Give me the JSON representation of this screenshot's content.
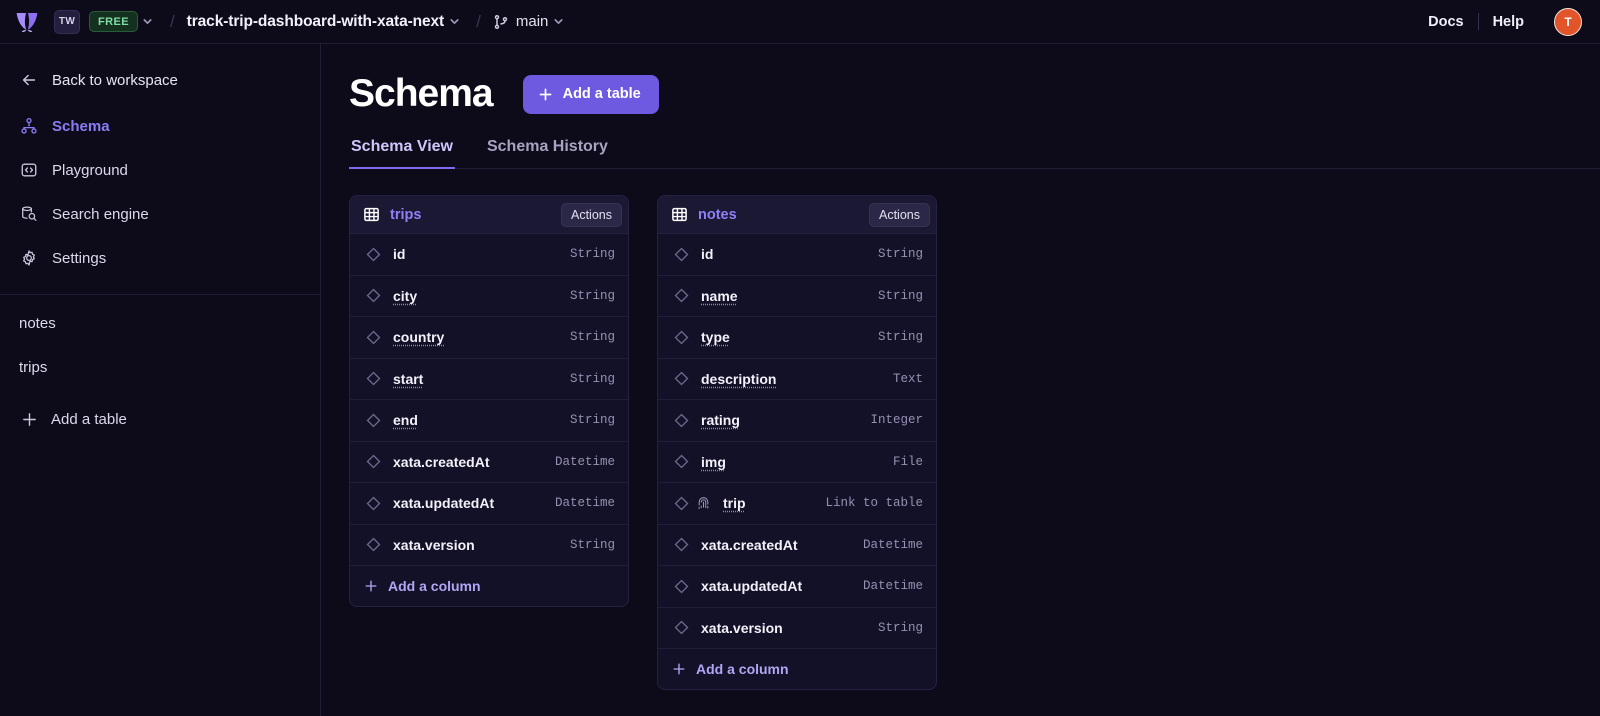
{
  "topbar": {
    "logo_icon": "xata-butterfly-logo",
    "workspace_badge": "TW",
    "plan_badge": "FREE",
    "separator": "/",
    "project_name": "track-trip-dashboard-with-xata-next",
    "branch_name": "main",
    "branch_icon": "git-branch-icon",
    "docs_label": "Docs",
    "help_label": "Help",
    "avatar_initial": "T",
    "avatar_color": "#e2552b"
  },
  "sidebar": {
    "back_label": "Back to workspace",
    "items": [
      {
        "label": "Schema",
        "icon": "schema-hierarchy-icon",
        "active": true
      },
      {
        "label": "Playground",
        "icon": "code-brackets-icon",
        "active": false
      },
      {
        "label": "Search engine",
        "icon": "database-search-icon",
        "active": false
      },
      {
        "label": "Settings",
        "icon": "gear-icon",
        "active": false
      }
    ],
    "tables": [
      "notes",
      "trips"
    ],
    "add_table_label": "Add a table"
  },
  "main": {
    "title": "Schema",
    "add_table_button": "Add a table",
    "tabs": [
      {
        "label": "Schema View",
        "active": true
      },
      {
        "label": "Schema History",
        "active": false
      }
    ],
    "accent_color": "#6d5ae0",
    "table_name_color": "#8e80f7"
  },
  "tables": [
    {
      "name": "trips",
      "actions_label": "Actions",
      "add_column_label": "Add a column",
      "columns": [
        {
          "name": "id",
          "type": "String",
          "dotted": false,
          "link": false
        },
        {
          "name": "city",
          "type": "String",
          "dotted": true,
          "link": false
        },
        {
          "name": "country",
          "type": "String",
          "dotted": true,
          "link": false
        },
        {
          "name": "start",
          "type": "String",
          "dotted": true,
          "link": false
        },
        {
          "name": "end",
          "type": "String",
          "dotted": true,
          "link": false
        },
        {
          "name": "xata.createdAt",
          "type": "Datetime",
          "dotted": false,
          "link": false
        },
        {
          "name": "xata.updatedAt",
          "type": "Datetime",
          "dotted": false,
          "link": false
        },
        {
          "name": "xata.version",
          "type": "String",
          "dotted": false,
          "link": false
        }
      ]
    },
    {
      "name": "notes",
      "actions_label": "Actions",
      "add_column_label": "Add a column",
      "columns": [
        {
          "name": "id",
          "type": "String",
          "dotted": false,
          "link": false
        },
        {
          "name": "name",
          "type": "String",
          "dotted": true,
          "link": false
        },
        {
          "name": "type",
          "type": "String",
          "dotted": true,
          "link": false
        },
        {
          "name": "description",
          "type": "Text",
          "dotted": true,
          "link": false
        },
        {
          "name": "rating",
          "type": "Integer",
          "dotted": true,
          "link": false
        },
        {
          "name": "img",
          "type": "File",
          "dotted": true,
          "link": false
        },
        {
          "name": "trip",
          "type": "Link to table",
          "dotted": true,
          "link": true
        },
        {
          "name": "xata.createdAt",
          "type": "Datetime",
          "dotted": false,
          "link": false
        },
        {
          "name": "xata.updatedAt",
          "type": "Datetime",
          "dotted": false,
          "link": false
        },
        {
          "name": "xata.version",
          "type": "String",
          "dotted": false,
          "link": false
        }
      ]
    }
  ]
}
